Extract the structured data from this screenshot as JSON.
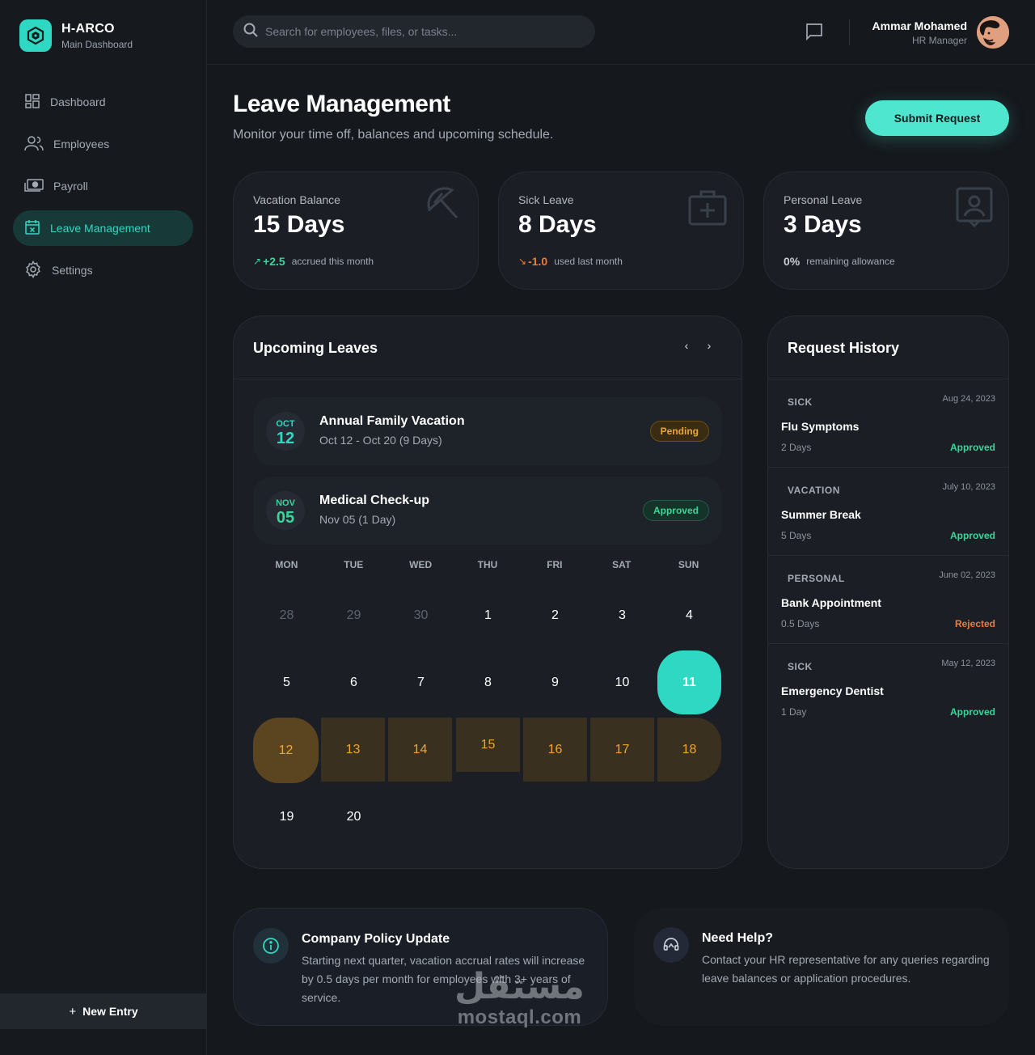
{
  "brand": {
    "title": "H-ARCO",
    "subtitle": "Main Dashboard"
  },
  "nav": {
    "items": [
      {
        "label": "Dashboard",
        "icon": "grid-icon"
      },
      {
        "label": "Employees",
        "icon": "users-icon"
      },
      {
        "label": "Payroll",
        "icon": "cash-icon"
      },
      {
        "label": "Leave Management",
        "icon": "calendar-x-icon",
        "active": true
      },
      {
        "label": "Settings",
        "icon": "gear-icon"
      }
    ],
    "new_entry": "New Entry"
  },
  "search": {
    "placeholder": "Search for employees, files, or tasks..."
  },
  "user": {
    "name": "Ammar Mohamed",
    "role": "HR Manager"
  },
  "header": {
    "title": "Leave Management",
    "subtitle": "Monitor your time off, balances and upcoming schedule.",
    "submit": "Submit Request"
  },
  "stats": [
    {
      "label": "Vacation Balance",
      "value": "15 Days",
      "delta": "+2.5",
      "note": "accrued this month",
      "delta_color": "#3ad59a",
      "icon": "umbrella-icon"
    },
    {
      "label": "Sick Leave",
      "value": "8 Days",
      "delta": "-1.0",
      "note": "used last month",
      "delta_color": "#f07a3a",
      "icon": "medical-kit-icon"
    },
    {
      "label": "Personal Leave",
      "value": "3 Days",
      "delta": "0%",
      "note": "remaining allowance",
      "delta_color": "#c9ced5",
      "icon": "id-badge-icon"
    }
  ],
  "upcoming": {
    "title": "Upcoming Leaves",
    "prev": "‹",
    "next": "›",
    "items": [
      {
        "month": "OCT",
        "day": "12",
        "title": "Annual Family Vacation",
        "range": "Oct 12 - Oct 20 (9 Days)",
        "status": "Pending",
        "month_color": "#2fd8c3"
      },
      {
        "month": "NOV",
        "day": "05",
        "title": "Medical Check-up",
        "range": "Nov 05 (1 Day)",
        "status": "Approved",
        "month_color": "#3ad59a"
      }
    ],
    "weekdays": [
      "MON",
      "TUE",
      "WED",
      "THU",
      "FRI",
      "SAT",
      "SUN"
    ],
    "weeks": [
      [
        "28",
        "29",
        "30",
        "1",
        "2",
        "3",
        "4"
      ],
      [
        "5",
        "6",
        "7",
        "8",
        "9",
        "10",
        "11"
      ],
      [
        "12",
        "13",
        "14",
        "15",
        "16",
        "17",
        "18"
      ],
      [
        "19",
        "20"
      ]
    ]
  },
  "history": {
    "title": "Request History",
    "items": [
      {
        "type": "SICK",
        "date": "Aug 24, 2023",
        "title": "Flu Symptoms",
        "duration": "2 Days",
        "status": "Approved",
        "status_color": "#3ad59a"
      },
      {
        "type": "VACATION",
        "date": "July 10, 2023",
        "title": "Summer Break",
        "duration": "5 Days",
        "status": "Approved",
        "status_color": "#3ad59a"
      },
      {
        "type": "PERSONAL",
        "date": "June 02, 2023",
        "title": "Bank Appointment",
        "duration": "0.5 Days",
        "status": "Rejected",
        "status_color": "#f07a3a"
      },
      {
        "type": "SICK",
        "date": "May 12, 2023",
        "title": "Emergency Dentist",
        "duration": "1 Day",
        "status": "Approved",
        "status_color": "#3ad59a"
      }
    ]
  },
  "policy": {
    "title": "Company Policy Update",
    "text": "Starting next quarter, vacation accrual rates will increase by 0.5 days per month for employees with 3+ years of service."
  },
  "help": {
    "title": "Need Help?",
    "text": "Contact your HR representative for any queries regarding leave balances or application procedures."
  },
  "watermark": {
    "arabic": "مستقل",
    "latin": "mostaql.com"
  },
  "colors": {
    "accent": "#2fd8c3",
    "pending": "#f0a531",
    "approved": "#3ad59a",
    "rejected": "#f07a3a"
  }
}
